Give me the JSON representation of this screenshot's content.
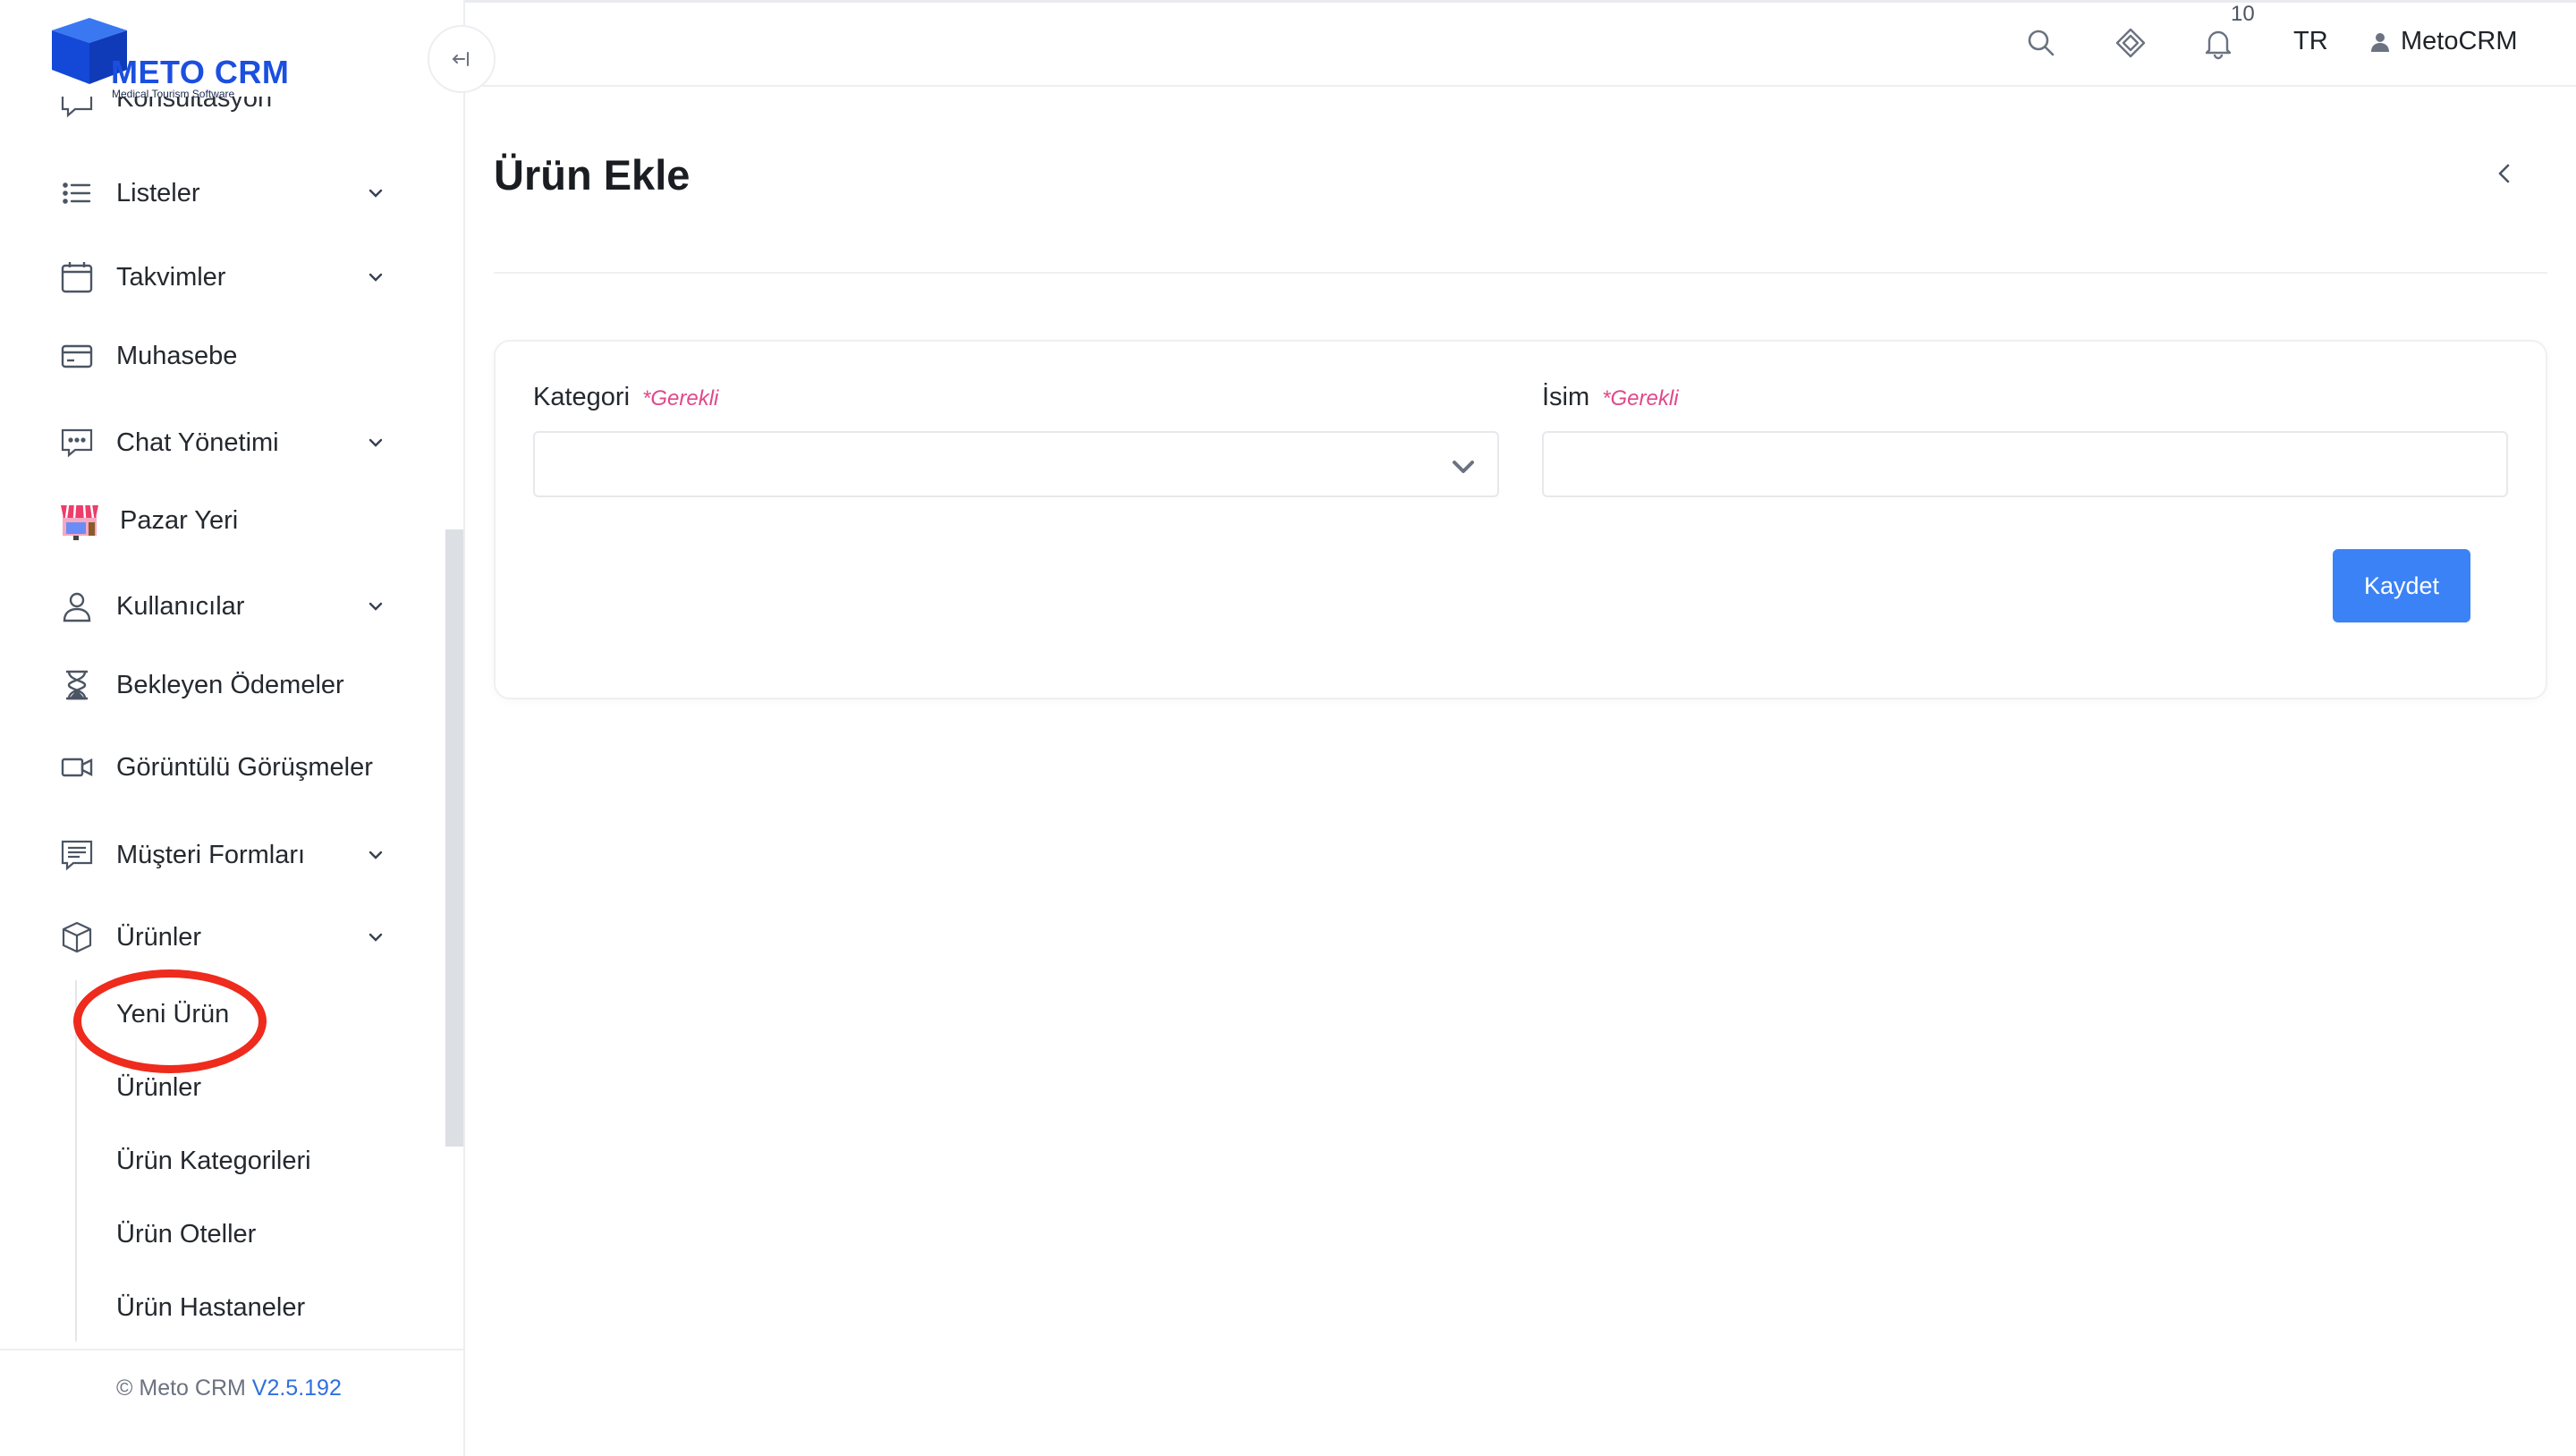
{
  "brand": {
    "name": "METO CRM",
    "tagline": "Medical Tourism Software"
  },
  "sidebar": {
    "partial_item": {
      "label": "Konsultasyon",
      "icon": "chat-bubble-icon"
    },
    "items": [
      {
        "label": "Listeler",
        "icon": "list-icon",
        "expandable": true
      },
      {
        "label": "Takvimler",
        "icon": "calendar-icon",
        "expandable": true
      },
      {
        "label": "Muhasebe",
        "icon": "credit-card-icon",
        "expandable": false
      },
      {
        "label": "Chat Yönetimi",
        "icon": "chat-dots-icon",
        "expandable": true
      },
      {
        "label": "Pazar Yeri",
        "icon": "marketplace-icon",
        "expandable": false
      },
      {
        "label": "Kullanıcılar",
        "icon": "user-icon",
        "expandable": true
      },
      {
        "label": "Bekleyen Ödemeler",
        "icon": "hourglass-icon",
        "expandable": false
      },
      {
        "label": "Görüntülü Görüşmeler",
        "icon": "video-camera-icon",
        "expandable": false
      },
      {
        "label": "Müşteri Formları",
        "icon": "form-icon",
        "expandable": true
      },
      {
        "label": "Ürünler",
        "icon": "box-icon",
        "expandable": true,
        "expanded": true
      }
    ],
    "sub_items": [
      {
        "label": "Yeni Ürün",
        "highlighted": true
      },
      {
        "label": "Ürünler"
      },
      {
        "label": "Ürün Kategorileri"
      },
      {
        "label": "Ürün Oteller"
      },
      {
        "label": "Ürün Hastaneler"
      }
    ],
    "footer": {
      "copyright": "© Meto CRM",
      "version": "V2.5.192"
    }
  },
  "header": {
    "notification_count": "10",
    "language": "TR",
    "user_name": "MetoCRM",
    "icons": [
      "search-icon",
      "diamond-icon",
      "bell-icon",
      "user-icon"
    ]
  },
  "page": {
    "title": "Ürün Ekle",
    "form": {
      "category_label": "Kategori",
      "category_required": "*Gerekli",
      "category_value": "",
      "name_label": "İsim",
      "name_required": "*Gerekli",
      "name_value": "",
      "name_placeholder": "",
      "save_label": "Kaydet"
    }
  },
  "colors": {
    "accent": "#3b82f6",
    "brand": "#1b4fe0",
    "required": "#e0488a",
    "highlight": "#ee2b1d"
  }
}
